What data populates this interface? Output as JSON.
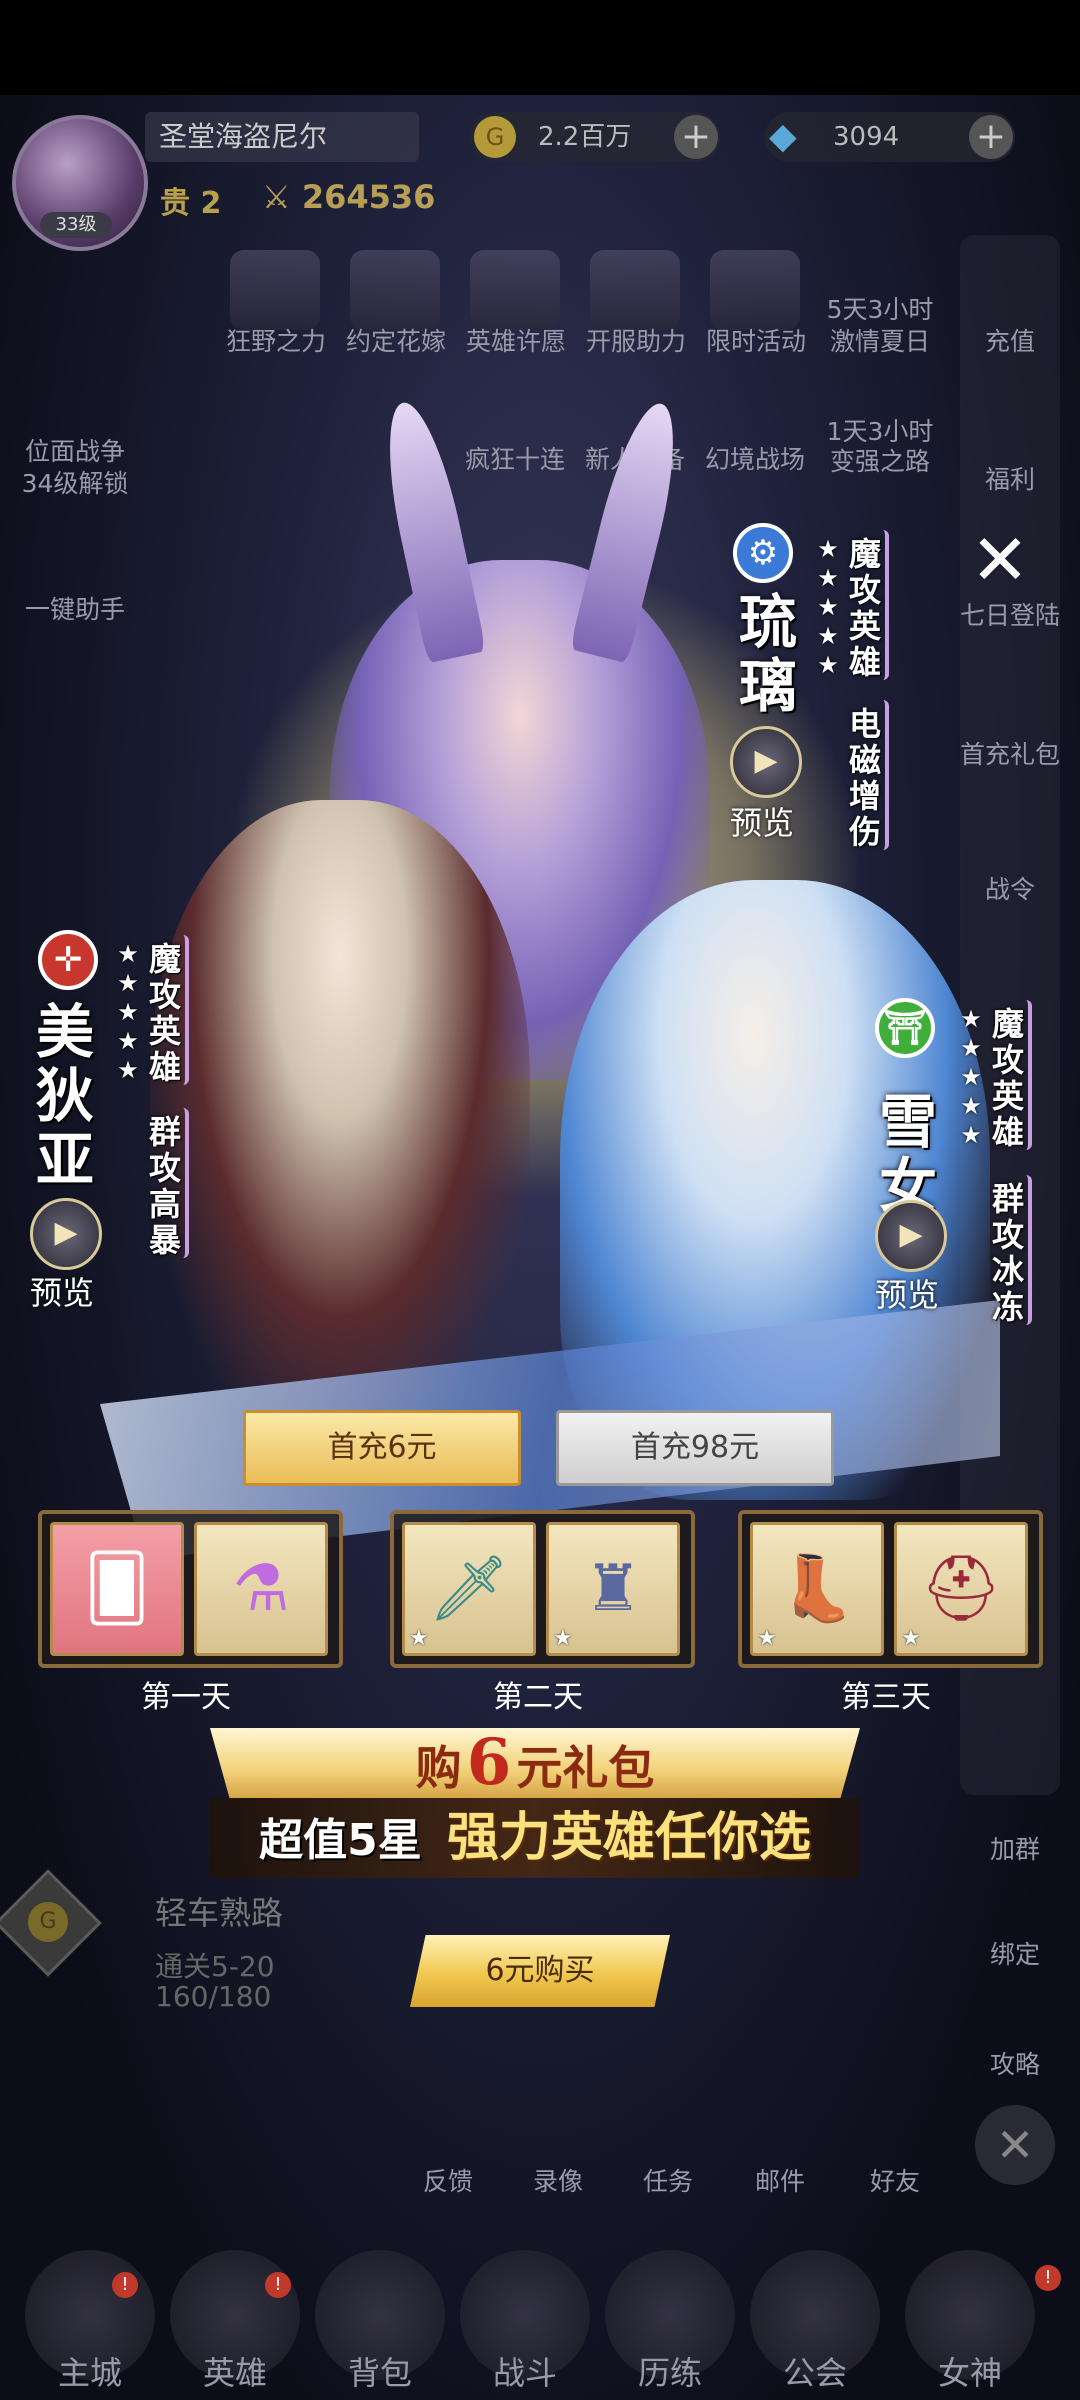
{
  "player": {
    "name": "圣堂海盗尼尔",
    "level": "33级",
    "vip": "贵 2",
    "power": "264536",
    "gold": "2.2百万",
    "gems": "3094"
  },
  "top_icons": [
    "狂野之力",
    "约定花嫁",
    "英雄许愿",
    "开服助力",
    "限时活动",
    "激情夏日"
  ],
  "top_icons_row2": [
    "疯狂十连",
    "新人必备",
    "幻境战场",
    "变强之路"
  ],
  "top_icon_timers": {
    "summer": "5天3小时",
    "grow": "1天3小时"
  },
  "left_icons": {
    "battle": "位面战争",
    "battle_sub": "34级解锁",
    "assistant": "一键助手"
  },
  "right_icons": [
    "充值",
    "福利",
    "七日登陆",
    "首充礼包",
    "战令"
  ],
  "popup": {
    "heroes": {
      "center": {
        "name": [
          "琉",
          "璃"
        ],
        "stars": 5,
        "class": [
          "魔",
          "攻",
          "英",
          "雄"
        ],
        "skill": [
          "电",
          "磁",
          "增",
          "伤"
        ],
        "preview": "预览",
        "element_icon": "gear-icon",
        "element_color": "#3b7ad6"
      },
      "left": {
        "name": [
          "美",
          "狄",
          "亚"
        ],
        "stars": 5,
        "class": [
          "魔",
          "攻",
          "英",
          "雄"
        ],
        "skill": [
          "群",
          "攻",
          "高",
          "暴"
        ],
        "preview": "预览",
        "element_icon": "sun-icon",
        "element_color": "#c8372d"
      },
      "right": {
        "name": [
          "雪",
          "女"
        ],
        "stars": 5,
        "class": [
          "魔",
          "攻",
          "英",
          "雄"
        ],
        "skill": [
          "群",
          "攻",
          "冰",
          "冻"
        ],
        "preview": "预览",
        "element_icon": "gate-icon",
        "element_color": "#3fae3a"
      }
    },
    "tabs": [
      "首充6元",
      "首充98元"
    ],
    "days": [
      "第一天",
      "第二天",
      "第三天"
    ],
    "banner_prefix": "购",
    "banner_amount": "6",
    "banner_suffix": "元礼包",
    "slogan_a": "超值5星",
    "slogan_b": "强力英雄任你选",
    "buy_button": "6元购买",
    "close_icon": "close-icon"
  },
  "quest": {
    "title": "轻车熟路",
    "stage": "通关5-20",
    "progress": "160/180"
  },
  "right_lower": [
    "加群",
    "绑定",
    "攻略"
  ],
  "bottom_row": [
    "反馈",
    "录像",
    "任务",
    "邮件",
    "好友"
  ],
  "nav": [
    "主城",
    "英雄",
    "背包",
    "战斗",
    "历练",
    "公会",
    "女神"
  ],
  "colors": {
    "gold": "#f3d27a",
    "banner_text": "#8a2a10",
    "amount": "#c2281b"
  }
}
